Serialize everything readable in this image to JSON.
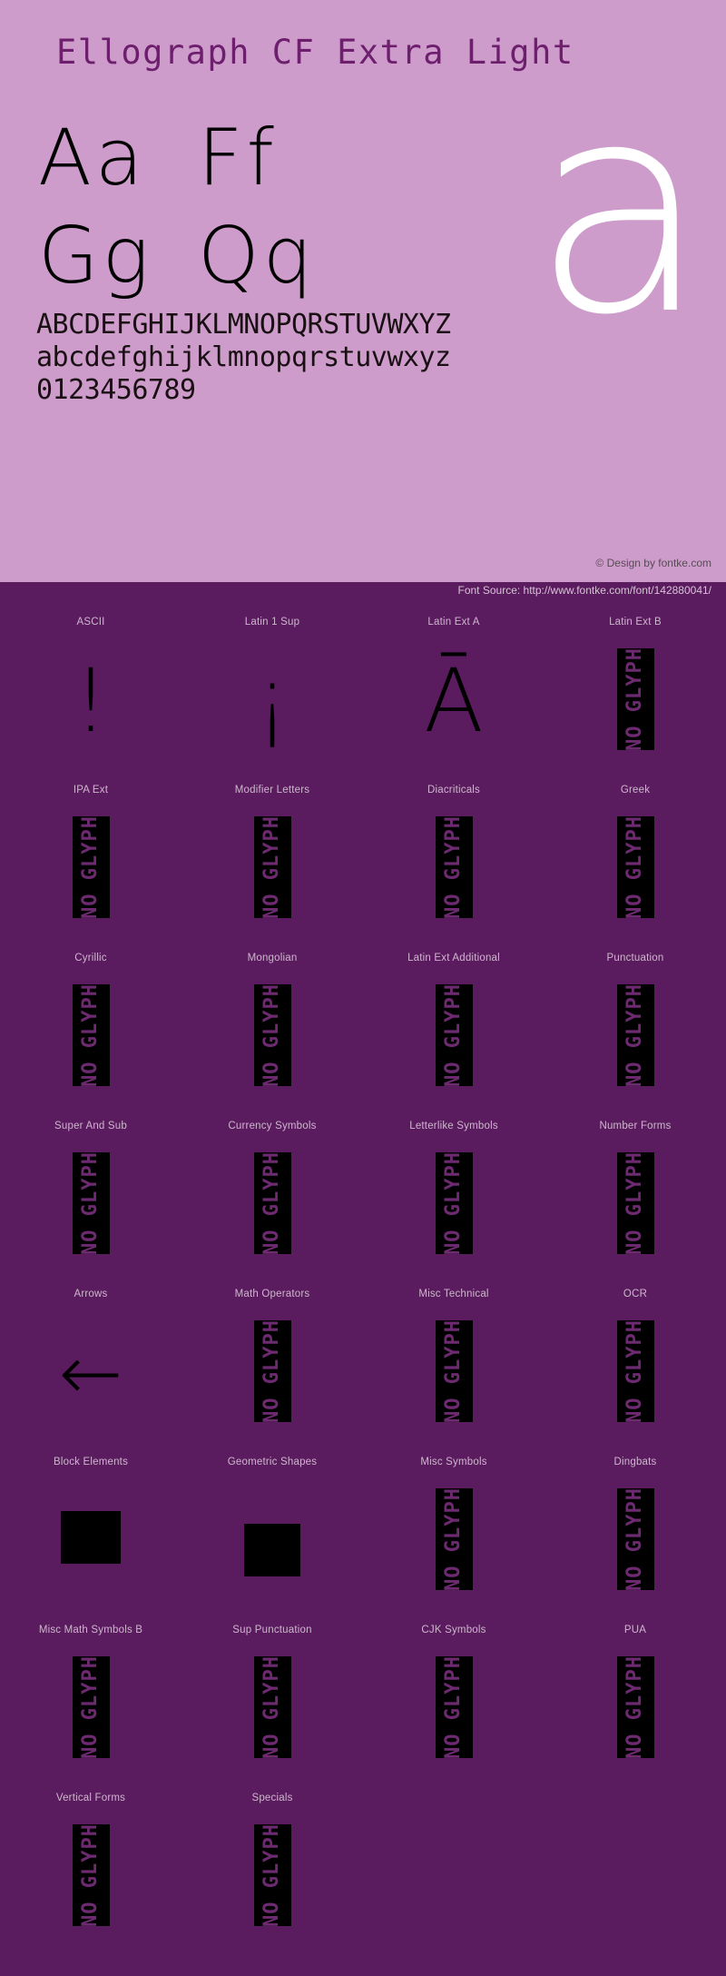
{
  "specimen": {
    "title": "Ellograph CF Extra Light",
    "watermark_glyph": "a",
    "letter_pairs": [
      [
        "Aa",
        "Ff"
      ],
      [
        "Gg",
        "Qq"
      ]
    ],
    "alphabet_lines": [
      "ABCDEFGHIJKLMNOPQRSTUVWXYZ",
      "abcdefghijklmnopqrstuvwxyz",
      "0123456789"
    ],
    "credit": "© Design by fontke.com",
    "source": "Font Source: http://www.fontke.com/font/142880041/"
  },
  "colors": {
    "specimen_background": "#cd9ccb",
    "page_background": "#5b1c5f",
    "glyph_black": "#000000",
    "title_purple": "#6d1f6e",
    "label_purple": "#cdb6cd",
    "no_glyph_text": "#6d2a70"
  },
  "no_glyph_text": "NO GLYPH",
  "block_rows": [
    [
      {
        "label": "ASCII",
        "glyph": "!",
        "kind": "char"
      },
      {
        "label": "Latin 1 Sup",
        "glyph": "¡",
        "kind": "char"
      },
      {
        "label": "Latin Ext A",
        "glyph": "Ā",
        "kind": "char"
      },
      {
        "label": "Latin Ext B",
        "glyph": "NO GLYPH",
        "kind": "no-glyph"
      }
    ],
    [
      {
        "label": "IPA Ext",
        "glyph": "NO GLYPH",
        "kind": "no-glyph"
      },
      {
        "label": "Modifier Letters",
        "glyph": "NO GLYPH",
        "kind": "no-glyph"
      },
      {
        "label": "Diacriticals",
        "glyph": "NO GLYPH",
        "kind": "no-glyph"
      },
      {
        "label": "Greek",
        "glyph": "NO GLYPH",
        "kind": "no-glyph"
      }
    ],
    [
      {
        "label": "Cyrillic",
        "glyph": "NO GLYPH",
        "kind": "no-glyph"
      },
      {
        "label": "Mongolian",
        "glyph": "NO GLYPH",
        "kind": "no-glyph"
      },
      {
        "label": "Latin Ext Additional",
        "glyph": "NO GLYPH",
        "kind": "no-glyph"
      },
      {
        "label": "Punctuation",
        "glyph": "NO GLYPH",
        "kind": "no-glyph"
      }
    ],
    [
      {
        "label": "Super And Sub",
        "glyph": "NO GLYPH",
        "kind": "no-glyph"
      },
      {
        "label": "Currency Symbols",
        "glyph": "NO GLYPH",
        "kind": "no-glyph"
      },
      {
        "label": "Letterlike Symbols",
        "glyph": "NO GLYPH",
        "kind": "no-glyph"
      },
      {
        "label": "Number Forms",
        "glyph": "NO GLYPH",
        "kind": "no-glyph"
      }
    ],
    [
      {
        "label": "Arrows",
        "glyph": "←",
        "kind": "arrow"
      },
      {
        "label": "Math Operators",
        "glyph": "NO GLYPH",
        "kind": "no-glyph"
      },
      {
        "label": "Misc Technical",
        "glyph": "NO GLYPH",
        "kind": "no-glyph"
      },
      {
        "label": "OCR",
        "glyph": "NO GLYPH",
        "kind": "no-glyph"
      }
    ],
    [
      {
        "label": "Block Elements",
        "glyph": "█",
        "kind": "block-full"
      },
      {
        "label": "Geometric Shapes",
        "glyph": "■",
        "kind": "block-square"
      },
      {
        "label": "Misc Symbols",
        "glyph": "NO GLYPH",
        "kind": "no-glyph"
      },
      {
        "label": "Dingbats",
        "glyph": "NO GLYPH",
        "kind": "no-glyph"
      }
    ],
    [
      {
        "label": "Misc Math Symbols B",
        "glyph": "NO GLYPH",
        "kind": "no-glyph"
      },
      {
        "label": "Sup Punctuation",
        "glyph": "NO GLYPH",
        "kind": "no-glyph"
      },
      {
        "label": "CJK Symbols",
        "glyph": "NO GLYPH",
        "kind": "no-glyph"
      },
      {
        "label": "PUA",
        "glyph": "NO GLYPH",
        "kind": "no-glyph"
      }
    ],
    [
      {
        "label": "Vertical Forms",
        "glyph": "NO GLYPH",
        "kind": "no-glyph"
      },
      {
        "label": "Specials",
        "glyph": "NO GLYPH",
        "kind": "no-glyph"
      },
      {
        "label": "",
        "glyph": "",
        "kind": "empty"
      },
      {
        "label": "",
        "glyph": "",
        "kind": "empty"
      }
    ]
  ]
}
